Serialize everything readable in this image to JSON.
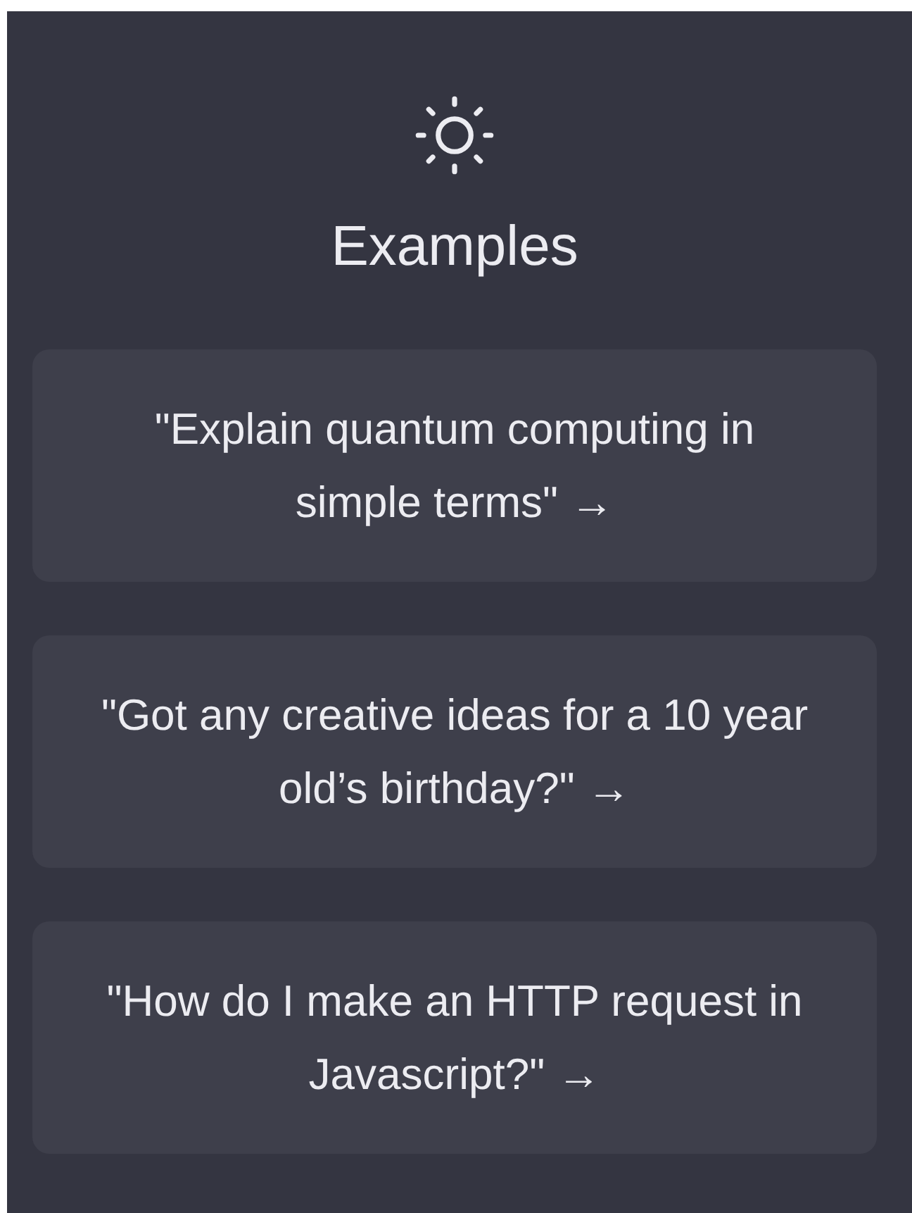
{
  "heading": "Examples",
  "examples": [
    {
      "text": "\"Explain quantum computing in simple terms\" →"
    },
    {
      "text": "\"Got any creative ideas for a 10 year old’s birthday?\" →"
    },
    {
      "text": "\"How do I make an HTTP request in Javascript?\" →"
    }
  ]
}
